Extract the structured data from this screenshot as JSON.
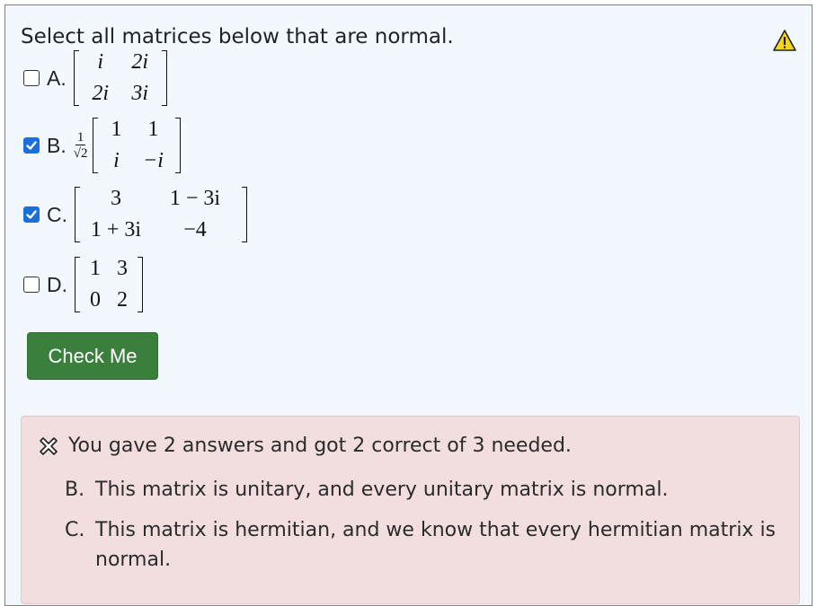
{
  "question": {
    "prompt": "Select all matrices below that are normal.",
    "warning_icon": "warning-triangle-icon"
  },
  "options": [
    {
      "letter": "A.",
      "checked": false,
      "matrix": [
        [
          "i",
          "2i"
        ],
        [
          "2i",
          "3i"
        ]
      ]
    },
    {
      "letter": "B.",
      "checked": true,
      "prefix": {
        "num": "1",
        "den": "√2"
      },
      "matrix": [
        [
          "1",
          "1"
        ],
        [
          "i",
          "−i"
        ]
      ]
    },
    {
      "letter": "C.",
      "checked": true,
      "matrix": [
        [
          "3",
          "1 − 3i"
        ],
        [
          "1 + 3i",
          "−4"
        ]
      ]
    },
    {
      "letter": "D.",
      "checked": false,
      "matrix": [
        [
          "1",
          "3"
        ],
        [
          "0",
          "2"
        ]
      ]
    }
  ],
  "check_button": {
    "label": "Check Me",
    "color": "#3b7f3d"
  },
  "feedback": {
    "icon": "x-mark-icon",
    "summary": "You gave 2 answers and got 2 correct of 3 needed.",
    "items": [
      {
        "letter": "B.",
        "text": "This matrix is unitary, and every unitary matrix is normal."
      },
      {
        "letter": "C.",
        "text": "This matrix is hermitian, and we know that every hermitian matrix is normal."
      }
    ],
    "background": "#f2dede"
  }
}
